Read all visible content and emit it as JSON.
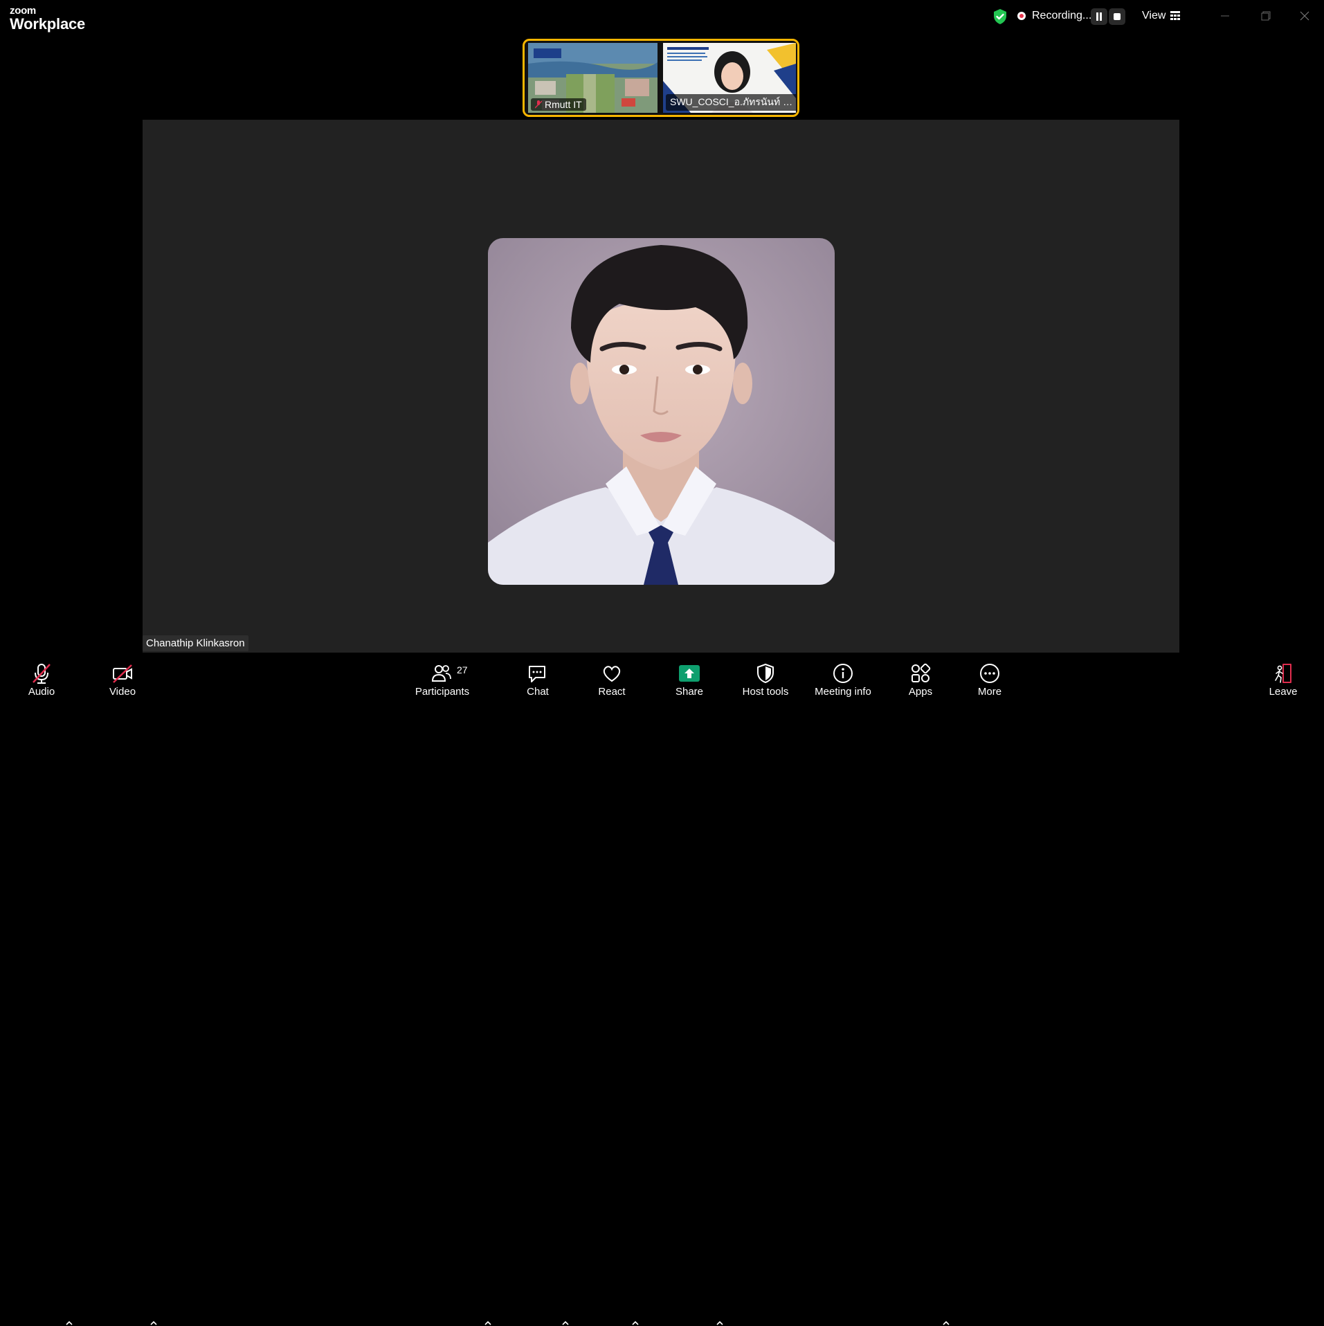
{
  "app": {
    "brand_small": "zoom",
    "brand_large": "Workplace"
  },
  "titlebar": {
    "recording_text": "Recording...",
    "view_label": "View"
  },
  "gallery": [
    {
      "name": "Rmutt IT",
      "muted": true
    },
    {
      "name": "SWU_COSCI_อ.ภัทรนันท์ ไว...",
      "muted": false
    }
  ],
  "stage": {
    "speaker_name": "Chanathip Klinkasron"
  },
  "toolbar": {
    "audio": "Audio",
    "video": "Video",
    "participants": "Participants",
    "participants_count": "27",
    "chat": "Chat",
    "react": "React",
    "share": "Share",
    "host_tools": "Host tools",
    "meeting_info": "Meeting info",
    "apps": "Apps",
    "more": "More",
    "leave": "Leave"
  },
  "colors": {
    "accent_share": "#0e9f6e",
    "recording": "#e8384f",
    "active_border": "#f7b500",
    "leave": "#e02d4e"
  }
}
